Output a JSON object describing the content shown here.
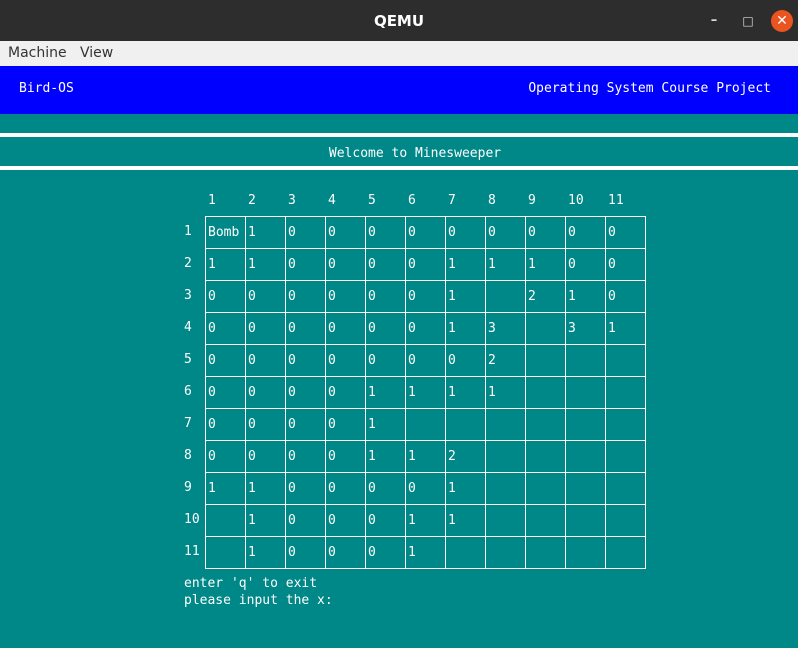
{
  "window": {
    "title": "QEMU",
    "minimize": "–",
    "maximize": "□",
    "close": "✕"
  },
  "menu": {
    "machine": "Machine",
    "view": "View"
  },
  "os": {
    "name": "Bird-OS",
    "subtitle": "Operating System Course Project",
    "welcome": "Welcome to Minesweeper"
  },
  "board": {
    "col_headers": [
      "1",
      "2",
      "3",
      "4",
      "5",
      "6",
      "7",
      "8",
      "9",
      "10",
      "11"
    ],
    "row_headers": [
      "1",
      "2",
      "3",
      "4",
      "5",
      "6",
      "7",
      "8",
      "9",
      "10",
      "11"
    ],
    "cells": [
      [
        "Bomb",
        "1",
        "0",
        "0",
        "0",
        "0",
        "0",
        "0",
        "0",
        "0",
        "0"
      ],
      [
        "1",
        "1",
        "0",
        "0",
        "0",
        "0",
        "1",
        "1",
        "1",
        "0",
        "0"
      ],
      [
        "0",
        "0",
        "0",
        "0",
        "0",
        "0",
        "1",
        "",
        "2",
        "1",
        "0"
      ],
      [
        "0",
        "0",
        "0",
        "0",
        "0",
        "0",
        "1",
        "3",
        "",
        "3",
        "1"
      ],
      [
        "0",
        "0",
        "0",
        "0",
        "0",
        "0",
        "0",
        "2",
        "",
        "",
        ""
      ],
      [
        "0",
        "0",
        "0",
        "0",
        "1",
        "1",
        "1",
        "1",
        "",
        "",
        ""
      ],
      [
        "0",
        "0",
        "0",
        "0",
        "1",
        "",
        "",
        "",
        "",
        "",
        ""
      ],
      [
        "0",
        "0",
        "0",
        "0",
        "1",
        "1",
        "2",
        "",
        "",
        "",
        ""
      ],
      [
        "1",
        "1",
        "0",
        "0",
        "0",
        "0",
        "1",
        "",
        "",
        "",
        ""
      ],
      [
        "",
        "1",
        "0",
        "0",
        "0",
        "1",
        "1",
        "",
        "",
        "",
        ""
      ],
      [
        "",
        "1",
        "0",
        "0",
        "0",
        "1",
        "",
        "",
        "",
        "",
        ""
      ]
    ]
  },
  "prompt": {
    "line1": "enter 'q' to exit",
    "line2": "please input the x:"
  }
}
